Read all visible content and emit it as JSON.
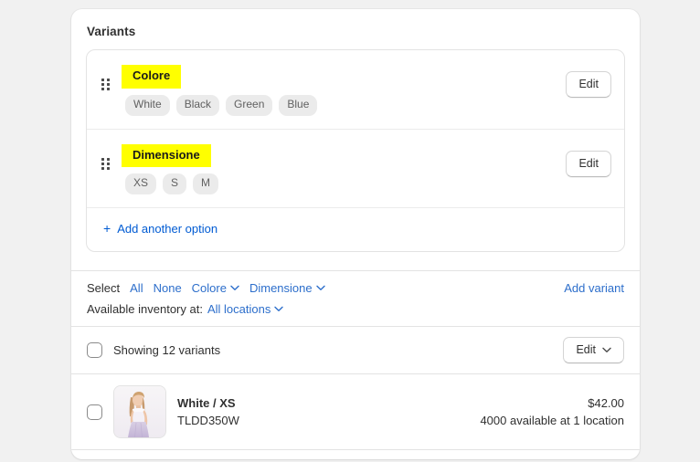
{
  "card": {
    "title": "Variants"
  },
  "options": [
    {
      "name": "Colore",
      "drag_handle_icon": "drag-handle-icon",
      "edit_label": "Edit",
      "values": [
        "White",
        "Black",
        "Green",
        "Blue"
      ]
    },
    {
      "name": "Dimensione",
      "drag_handle_icon": "drag-handle-icon",
      "edit_label": "Edit",
      "values": [
        "XS",
        "S",
        "M"
      ]
    }
  ],
  "add_option": {
    "plus_icon": "plus-icon",
    "label": "Add another option"
  },
  "select_bar": {
    "select_label": "Select",
    "all_label": "All",
    "none_label": "None",
    "colore_label": "Colore",
    "dimensione_label": "Dimensione",
    "add_variant_label": "Add variant",
    "inventory_label": "Available inventory at:",
    "locations_value": "All locations",
    "chevron_icon": "chevron-down-icon"
  },
  "showing_row": {
    "checkbox_icon": "checkbox-unchecked-icon",
    "text": "Showing 12 variants",
    "edit_label": "Edit",
    "chevron_icon": "chevron-down-icon"
  },
  "variants": [
    {
      "checkbox_icon": "checkbox-unchecked-icon",
      "thumbnail_icon": "product-photo-white-dress",
      "title": "White / XS",
      "sku": "TLDD350W",
      "price": "$42.00",
      "stock": "4000 available at 1 location"
    }
  ],
  "colors": {
    "highlight": "#FFFF00",
    "link": "#2C6ECB",
    "link_alt": "#005BD3",
    "text": "#303030",
    "pill_bg": "#EBEBEB",
    "pill_text": "#616161",
    "page_bg": "#F1F1F1"
  }
}
